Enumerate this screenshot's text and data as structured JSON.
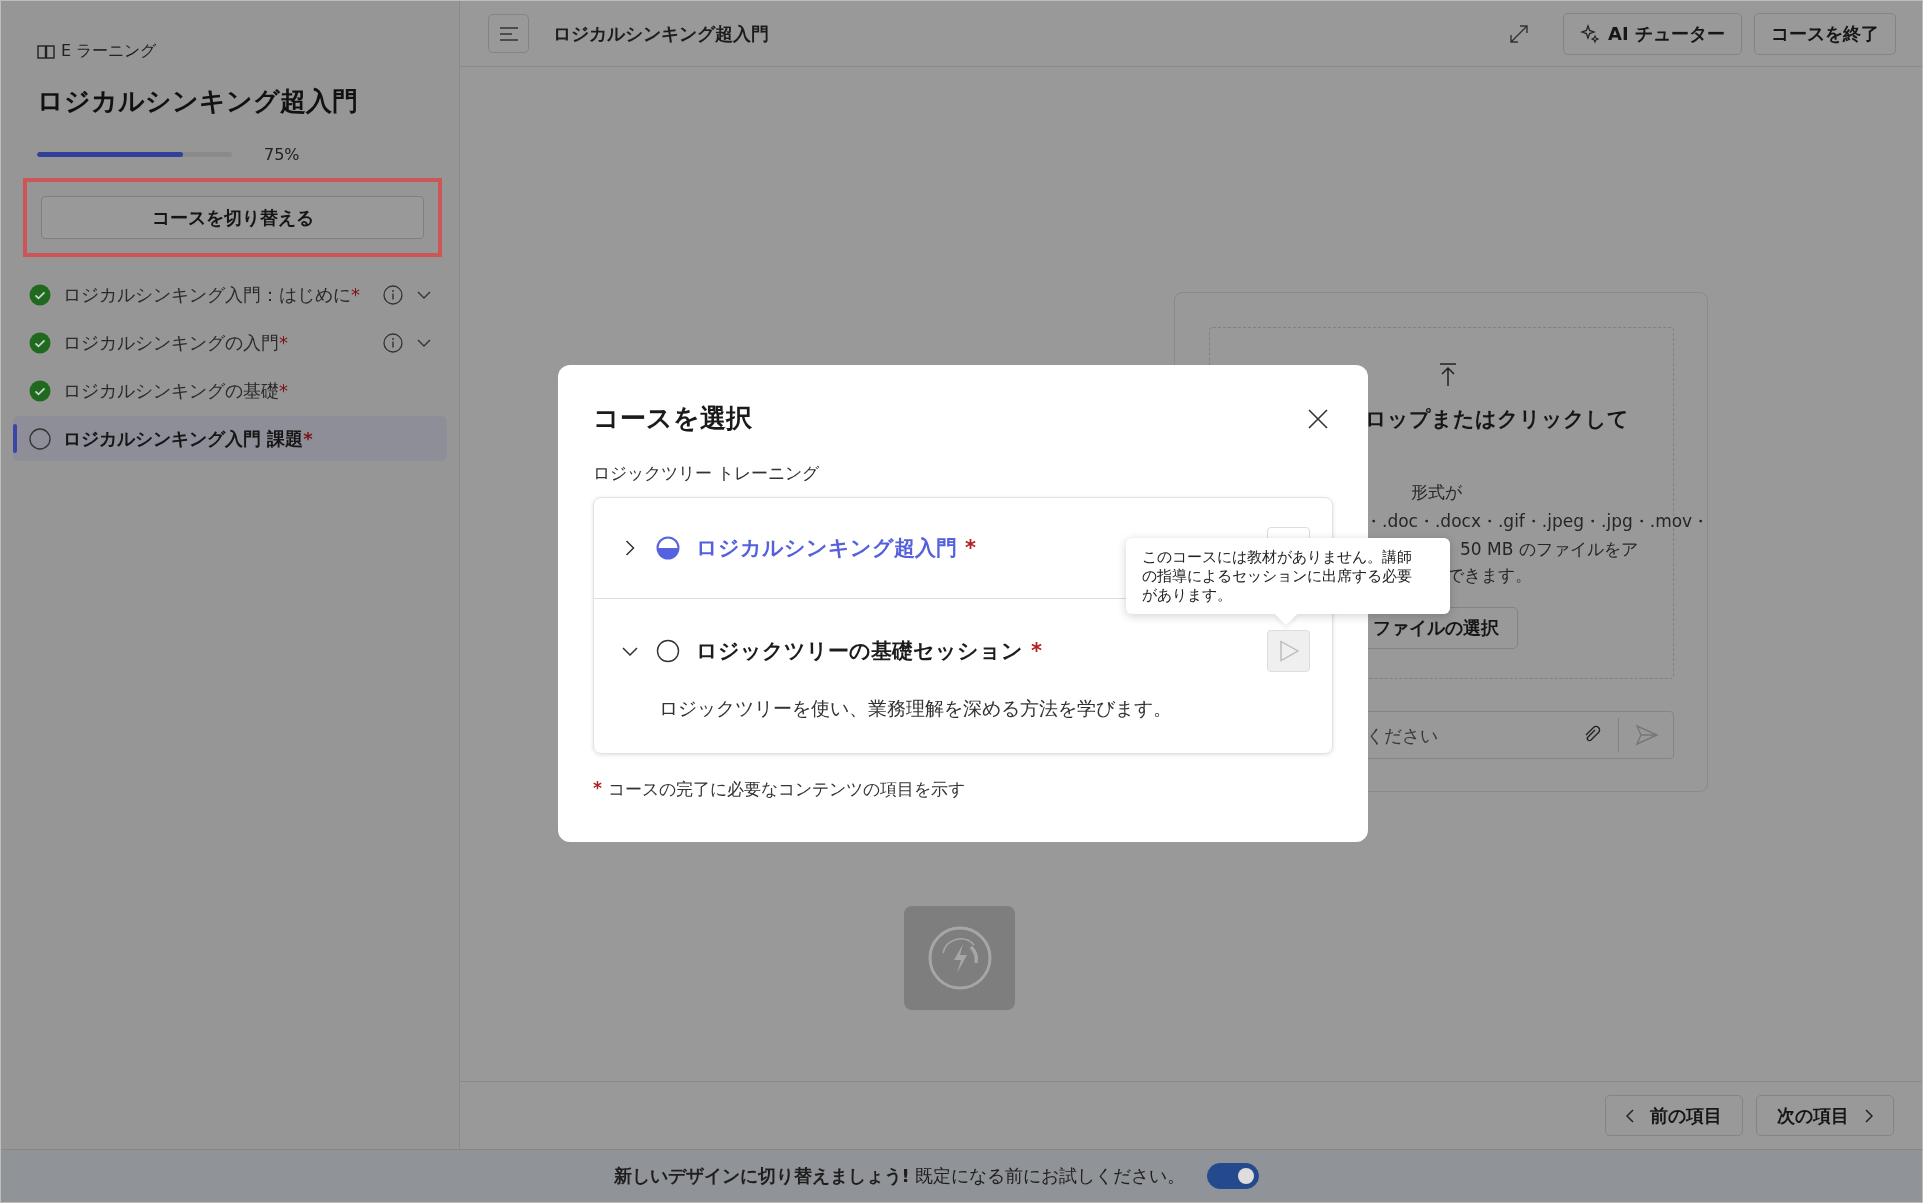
{
  "sidebar": {
    "section_label": "E ラーニング",
    "title": "ロジカルシンキング超入門",
    "progress": {
      "level": 0.75,
      "label": "75%"
    },
    "switch_button": {
      "label": "コースを切り替える",
      "highlighted": true
    },
    "items": [
      {
        "label": "ロジカルシンキング入門：はじめに",
        "mark": "*",
        "completed": true,
        "info": true,
        "expandable": true,
        "selected": false
      },
      {
        "label": "ロジカルシンキングの入門",
        "mark": "*",
        "completed": true,
        "info": true,
        "expandable": true,
        "selected": false
      },
      {
        "label": "ロジカルシンキングの基礎",
        "mark": "*",
        "completed": true,
        "info": false,
        "expandable": false,
        "selected": false
      },
      {
        "label": "ロジカルシンキング入門 課題",
        "mark": "*",
        "completed": false,
        "info": false,
        "expandable": false,
        "selected": true
      }
    ]
  },
  "header": {
    "title": "ロジカルシンキング超入門",
    "buttons": [
      {
        "label": "AI チューター",
        "kind": "ai"
      },
      {
        "label": "コースを終了",
        "kind": "plain"
      }
    ]
  },
  "upload": {
    "heading": "ロップまたはクリックして",
    "formats_label": "形式が",
    "formats": "・.doc・.docx・.gif・.jpeg・.jpg・.mov・",
    "size_note": "50 MB のファイルをア",
    "size_note_end": "できます。",
    "choose_button": "ファイルの選択",
    "input_placeholder": "ください"
  },
  "footer_nav": [
    {
      "label": "前の項目",
      "kind": "prev"
    },
    {
      "label": "次の項目",
      "kind": "next"
    }
  ],
  "banner": {
    "text": "**新しいデザインに切り替えましょう!** 既定になる前にお試しください。",
    "toggle_on": true
  },
  "dialog": {
    "title": "コースを選択",
    "group_label": "ロジックツリー トレーニング",
    "courses": [
      {
        "title": "ロジカルシンキング超入門",
        "mark": "*",
        "kind": "in_progress",
        "expanded": false,
        "selected": true,
        "play_disabled": false,
        "play_covered": true
      },
      {
        "title": "ロジックツリーの基礎セッション",
        "mark": "*",
        "kind": "not_started",
        "expanded": true,
        "selected": false,
        "play_disabled": true,
        "description": "ロジックツリーを使い、業務理解を深める方法を学びます。"
      }
    ],
    "tooltip": "このコースには教材がありません。講師の指導によるセッションに出席する必要があります。",
    "legend": {
      "mark": "*",
      "text": "コースの完了に必要なコンテンツの項目を示す"
    }
  }
}
